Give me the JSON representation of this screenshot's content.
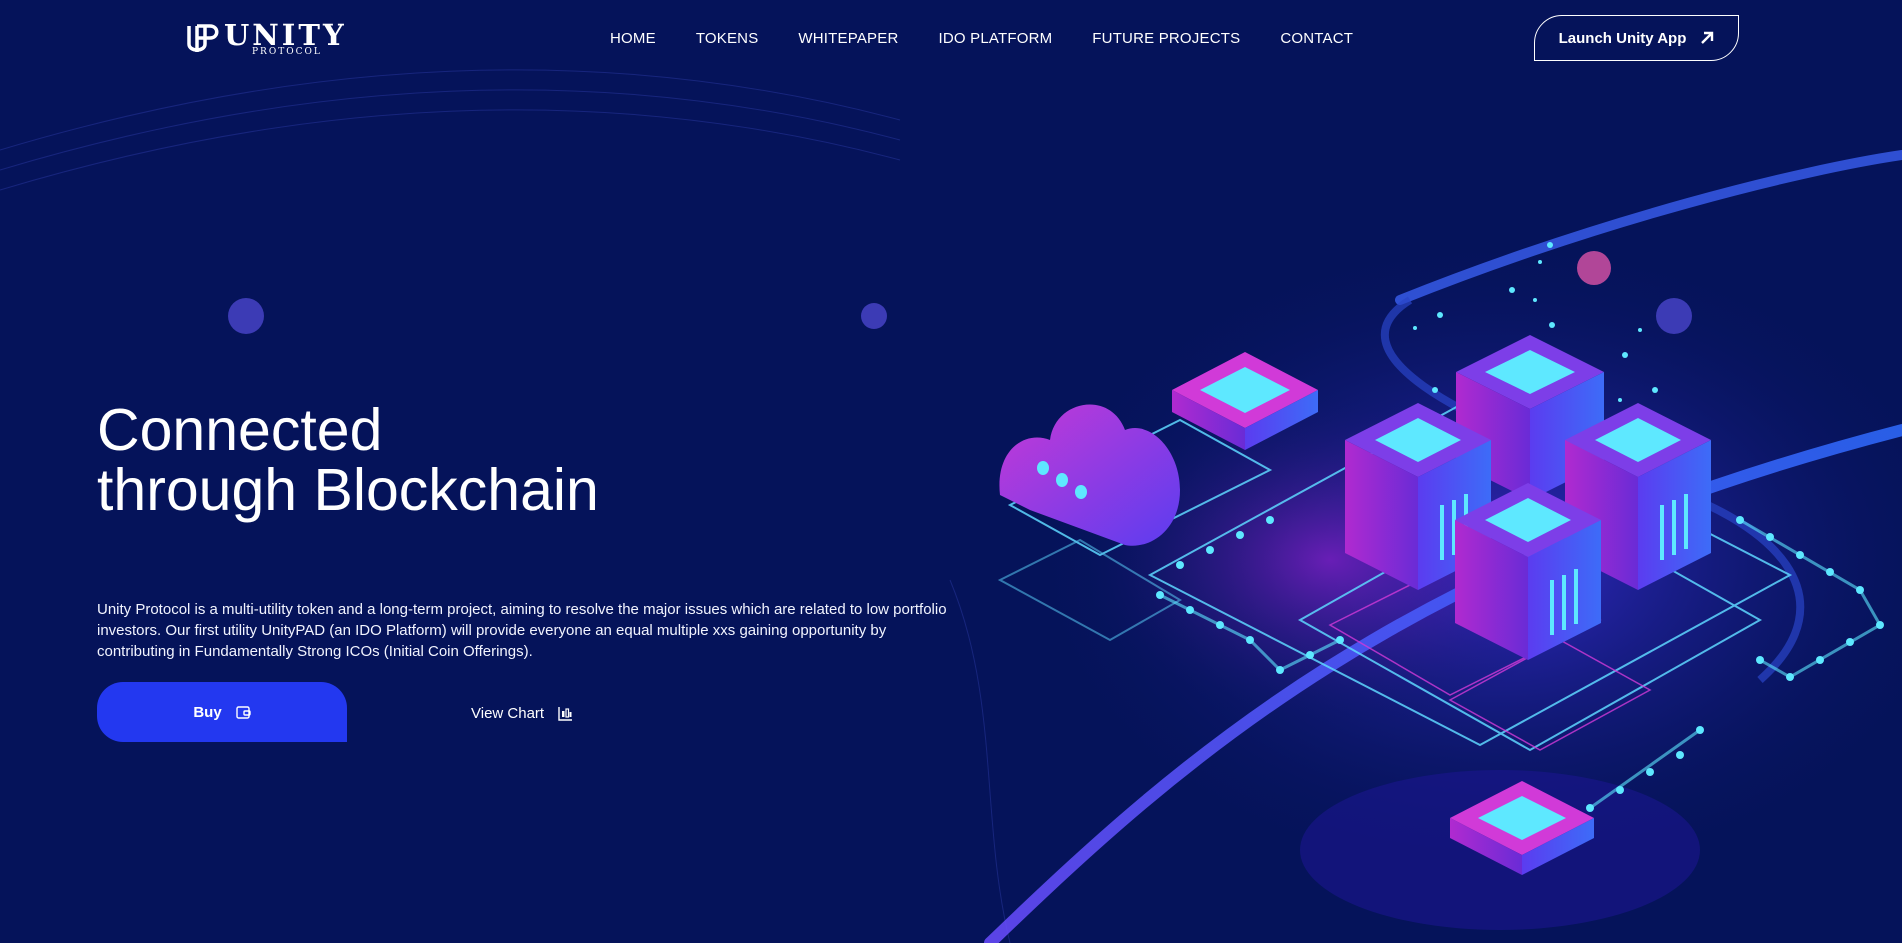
{
  "brand": {
    "name": "UNITY",
    "sub": "PROTOCOL"
  },
  "nav": {
    "items": [
      "HOME",
      "TOKENS",
      "WHITEPAPER",
      "IDO PLATFORM",
      "FUTURE PROJECTS",
      "CONTACT"
    ]
  },
  "header": {
    "launch_label": "Launch Unity App",
    "launch_icon": "arrow-up-right-icon"
  },
  "hero": {
    "title_line1": "Connected",
    "title_line2": "through Blockchain",
    "description": "Unity Protocol is a multi-utility token and a long-term project, aiming to resolve the major issues which are related to low portfolio investors. Our first utility UnityPAD (an IDO Platform) will provide everyone an equal multiple xxs gaining opportunity by contributing in Fundamentally Strong ICOs (Initial Coin Offerings).",
    "buy_label": "Buy",
    "buy_icon": "wallet-icon",
    "view_chart_label": "View Chart",
    "view_chart_icon": "candlestick-chart-icon"
  },
  "colors": {
    "background": "#05135a",
    "accent": "#2338f0",
    "neon_cyan": "#5ee8ff",
    "neon_magenta": "#d13ad8"
  }
}
